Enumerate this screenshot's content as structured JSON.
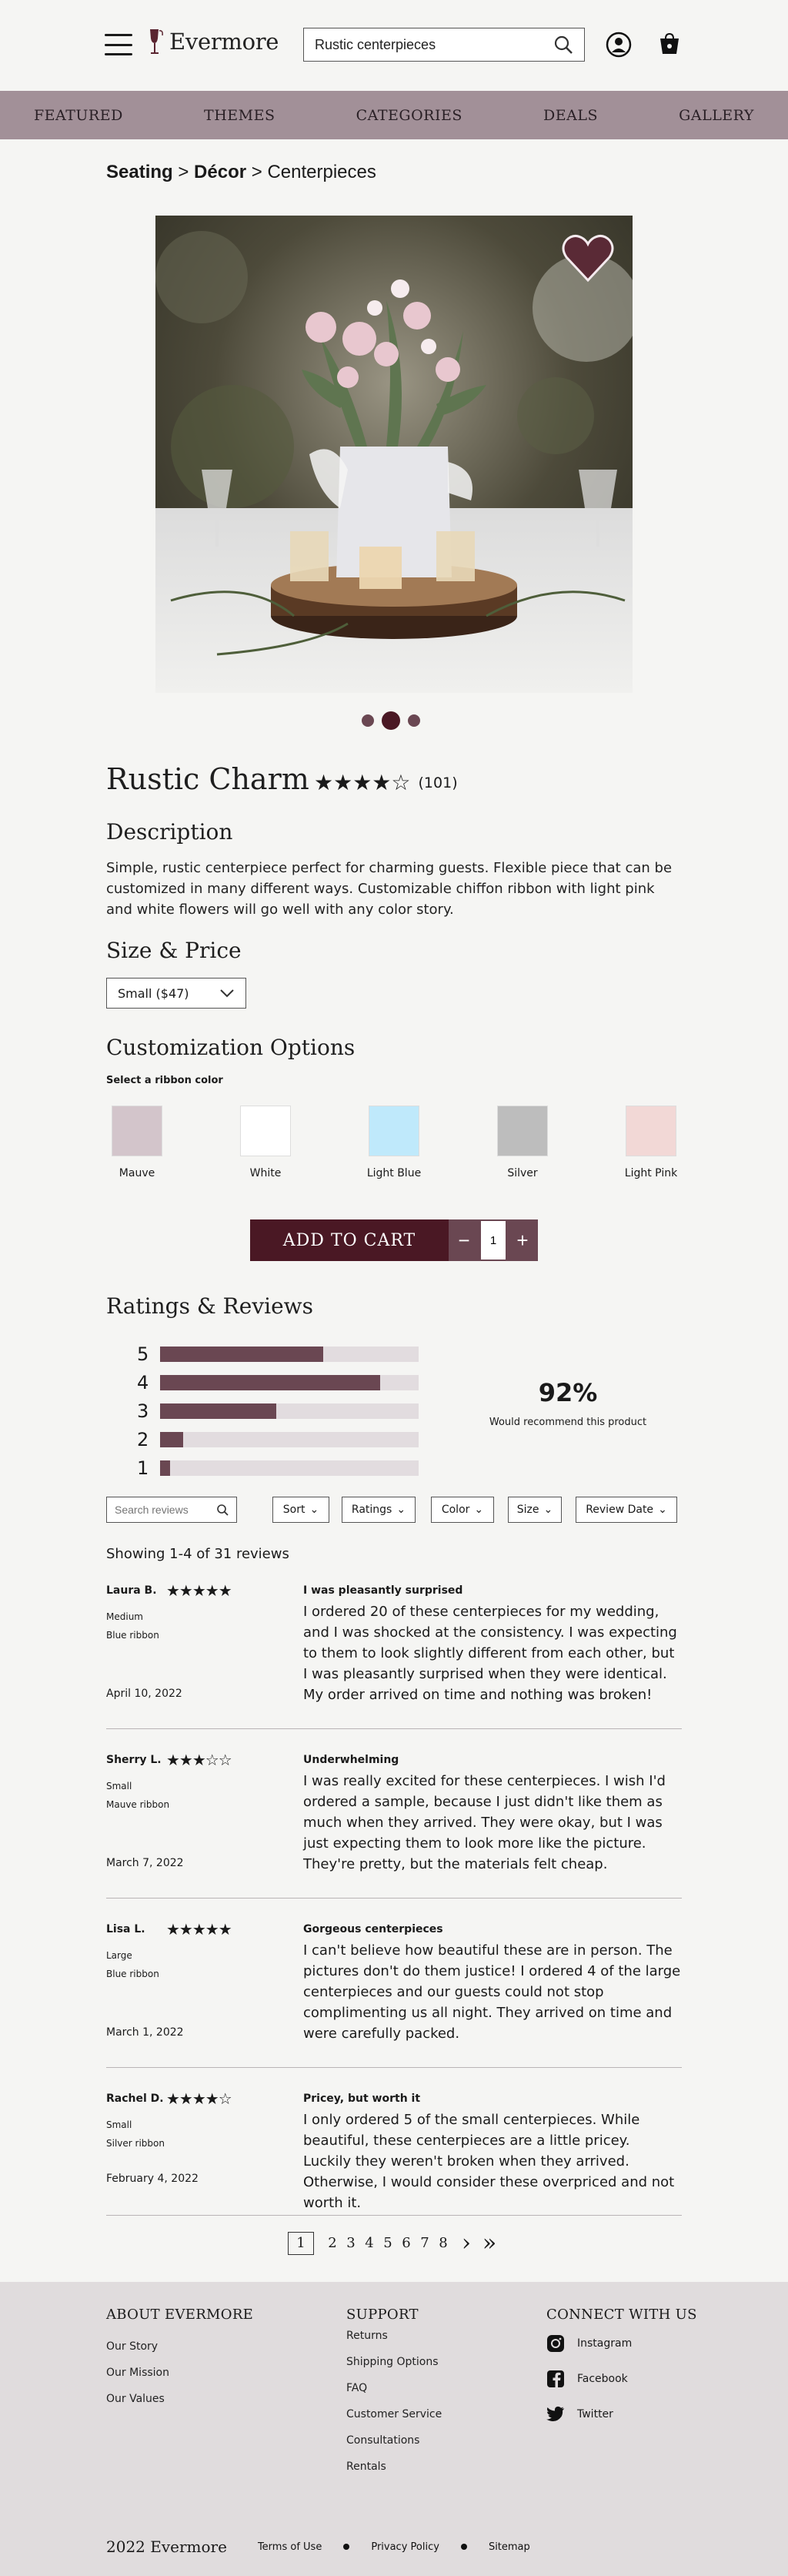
{
  "brand": {
    "name": "Evermore",
    "accent": "#4a1824",
    "muted_accent": "#6a4752",
    "nav_bg": "#a29098"
  },
  "search": {
    "value": "Rustic centerpieces"
  },
  "nav": [
    "FEATURED",
    "THEMES",
    "CATEGORIES",
    "DEALS",
    "GALLERY"
  ],
  "breadcrumb": {
    "level1": "Seating",
    "sep1": ">",
    "level2": "Décor",
    "sep2": ">",
    "current": "Centerpieces"
  },
  "product": {
    "title": "Rustic Charm",
    "rating": 4,
    "rating_max": 5,
    "review_count": "(101)",
    "image_dots": 3,
    "image_active": 1
  },
  "description": {
    "heading": "Description",
    "text": "Simple, rustic centerpiece perfect for charming guests. Flexible piece that can be customized in many different ways. Customizable chiffon ribbon with light pink and white flowers will go well with any color story."
  },
  "size_price": {
    "heading": "Size & Price",
    "selected": "Small ($47)"
  },
  "customization": {
    "heading": "Customization Options",
    "subheading": "Select a ribbon color",
    "swatches": [
      {
        "label": "Mauve",
        "color": "#d3c5cb"
      },
      {
        "label": "White",
        "color": "#ffffff"
      },
      {
        "label": "Light Blue",
        "color": "#bfe9fb"
      },
      {
        "label": "Silver",
        "color": "#bdbdbd"
      },
      {
        "label": "Light Pink",
        "color": "#f2d8d6"
      }
    ]
  },
  "cart": {
    "add_label": "ADD TO CART",
    "minus": "−",
    "plus": "+",
    "quantity": "1"
  },
  "ratings": {
    "heading": "Ratings & Reviews",
    "distribution": [
      {
        "stars": "5",
        "fraction": 0.63
      },
      {
        "stars": "4",
        "fraction": 0.85
      },
      {
        "stars": "3",
        "fraction": 0.45
      },
      {
        "stars": "2",
        "fraction": 0.09
      },
      {
        "stars": "1",
        "fraction": 0.04
      }
    ],
    "recommend_pct": "92%",
    "recommend_label": "Would recommend this product"
  },
  "filters": {
    "search_placeholder": "Search reviews",
    "sort": "Sort",
    "ratings": "Ratings",
    "color": "Color",
    "size": "Size",
    "review_date": "Review Date"
  },
  "showing": "Showing 1-4 of 31 reviews",
  "reviews": [
    {
      "name": "Laura B.",
      "stars": 5,
      "size": "Medium",
      "ribbon": "Blue ribbon",
      "date": "April 10, 2022",
      "title": "I was pleasantly surprised",
      "body": "I ordered 20 of these centerpieces for my wedding, and I was shocked at the consistency. I was expecting to them to look slightly different from each other, but I was pleasantly surprised when they were identical. My order arrived on time and nothing was broken!"
    },
    {
      "name": "Sherry L.",
      "stars": 3,
      "size": "Small",
      "ribbon": "Mauve ribbon",
      "date": "March 7, 2022",
      "title": "Underwhelming",
      "body": "I was really excited for these centerpieces. I wish I'd ordered a sample, because I just didn't like them as much when they arrived. They were okay, but I was just expecting them to look more like the picture. They're pretty, but the materials felt cheap."
    },
    {
      "name": "Lisa L.",
      "stars": 5,
      "size": "Large",
      "ribbon": "Blue ribbon",
      "date": "March 1, 2022",
      "title": "Gorgeous centerpieces",
      "body": "I can't believe how beautiful these are in person. The pictures don't do them justice! I ordered 4 of the large centerpieces and our guests could not stop complimenting us all night. They arrived on time and were carefully packed."
    },
    {
      "name": "Rachel D.",
      "stars": 4,
      "size": "Small",
      "ribbon": "Silver ribbon",
      "date": "February 4, 2022",
      "title": "Pricey, but worth it",
      "body": "I only ordered 5 of the small centerpieces. While beautiful, these centerpieces are a little pricey. Luckily they weren't broken when they arrived. Otherwise, I would consider these overpriced and not worth it."
    }
  ],
  "pagination": {
    "current": "1",
    "pages": [
      "2",
      "3",
      "4",
      "5",
      "6",
      "7",
      "8"
    ],
    "next": "›",
    "last": "»"
  },
  "footer": {
    "about": {
      "heading": "ABOUT EVERMORE",
      "links": [
        "Our Story",
        "Our Mission",
        "Our Values"
      ]
    },
    "support": {
      "heading": "SUPPORT",
      "links": [
        "Returns",
        "Shipping Options",
        "FAQ",
        "Customer Service",
        "Consultations",
        "Rentals"
      ]
    },
    "connect": {
      "heading": "CONNECT WITH US",
      "instagram": "Instagram",
      "facebook": "Facebook",
      "twitter": "Twitter"
    },
    "copyright": "2022 Evermore",
    "terms": "Terms of Use",
    "privacy": "Privacy Policy",
    "sitemap": "Sitemap"
  }
}
